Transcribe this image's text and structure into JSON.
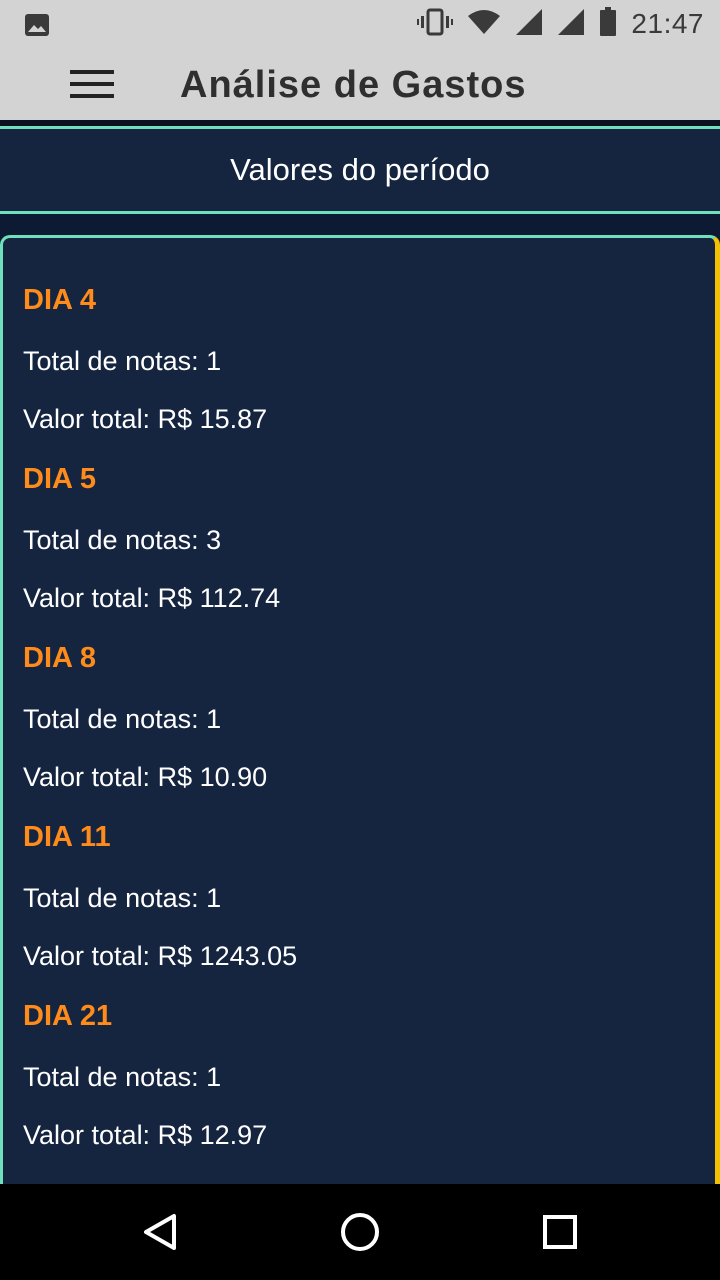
{
  "status_bar": {
    "time": "21:47",
    "icons": [
      "image-icon",
      "vibrate-icon",
      "wifi-icon",
      "signal-icon",
      "signal-icon",
      "battery-icon"
    ]
  },
  "app_bar": {
    "title": "Análise de Gastos",
    "menu_icon": "hamburger-menu-icon"
  },
  "section": {
    "title": "Valores do período"
  },
  "days": [
    {
      "title": "DIA 4",
      "count": "Total de notas: 1",
      "value": "Valor total: R$ 15.87"
    },
    {
      "title": "DIA 5",
      "count": "Total de notas: 3",
      "value": "Valor total: R$ 112.74"
    },
    {
      "title": "DIA 8",
      "count": "Total de notas: 1",
      "value": "Valor total: R$ 10.90"
    },
    {
      "title": "DIA 11",
      "count": "Total de notas: 1",
      "value": "Valor total: R$ 1243.05"
    },
    {
      "title": "DIA 21",
      "count": "Total de notas: 1",
      "value": "Valor total: R$ 12.97"
    }
  ],
  "colors": {
    "accent": "#6ee0bb",
    "day_title": "#ff8c1a",
    "card_bg": "#152540",
    "scroll_indicator": "#f2c200"
  },
  "nav_bar": {
    "icons": [
      "back-icon",
      "home-icon",
      "recents-icon"
    ]
  }
}
